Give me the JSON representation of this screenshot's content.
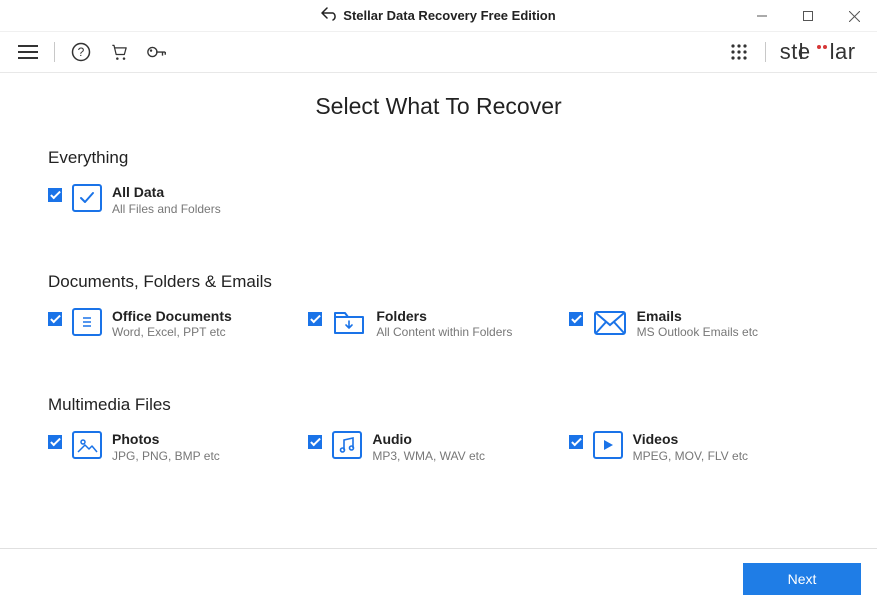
{
  "titlebar": {
    "app_title": "Stellar Data Recovery Free Edition"
  },
  "toolbar": {
    "logo_text": "stellar"
  },
  "main": {
    "heading": "Select What To Recover",
    "sections": {
      "everything": {
        "title": "Everything",
        "item": {
          "title": "All Data",
          "sub": "All Files and Folders"
        }
      },
      "documents": {
        "title": "Documents, Folders & Emails",
        "items": [
          {
            "title": "Office Documents",
            "sub": "Word, Excel, PPT etc"
          },
          {
            "title": "Folders",
            "sub": "All Content within Folders"
          },
          {
            "title": "Emails",
            "sub": "MS Outlook Emails etc"
          }
        ]
      },
      "multimedia": {
        "title": "Multimedia Files",
        "items": [
          {
            "title": "Photos",
            "sub": "JPG, PNG, BMP etc"
          },
          {
            "title": "Audio",
            "sub": "MP3, WMA, WAV etc"
          },
          {
            "title": "Videos",
            "sub": "MPEG, MOV, FLV etc"
          }
        ]
      }
    }
  },
  "footer": {
    "next_label": "Next"
  }
}
